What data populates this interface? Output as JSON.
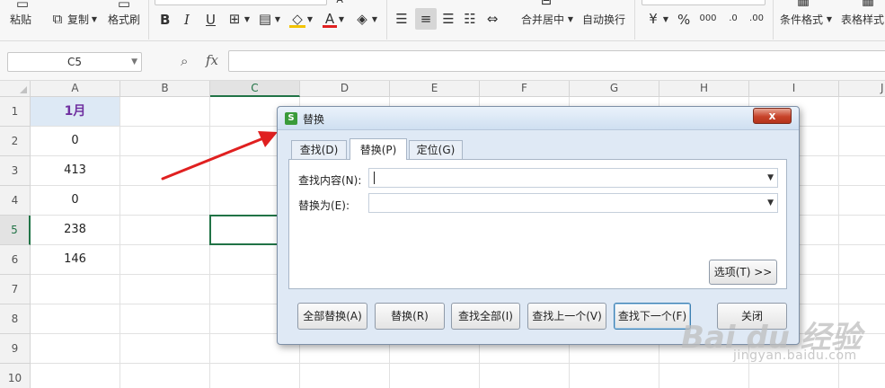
{
  "ribbon": {
    "paste_label": "粘贴",
    "copy_label": "复制",
    "format_painter_label": "格式刷",
    "bold_label": "B",
    "italic_label": "I",
    "underline_label": "U",
    "merge_center_label": "合并居中",
    "wrap_text_label": "自动换行",
    "percent_label": "%",
    "conditional_format_label": "条件格式",
    "table_style_label": "表格样式"
  },
  "formula_bar": {
    "cell_reference": "C5",
    "fx_label": "fx",
    "formula_value": ""
  },
  "sheet": {
    "columns": [
      "A",
      "B",
      "C",
      "D",
      "E",
      "F",
      "G",
      "H",
      "I",
      "J"
    ],
    "selected_column": "C",
    "rows": [
      "1",
      "2",
      "3",
      "4",
      "5",
      "6",
      "7",
      "8",
      "9",
      "10"
    ],
    "selected_row": "5",
    "cells_a": [
      "1月",
      "0",
      "413",
      "0",
      "238",
      "146",
      "",
      "",
      "",
      ""
    ],
    "active_cell": "C5"
  },
  "dialog": {
    "title": "替换",
    "app_icon_letter": "S",
    "close_label": "x",
    "tabs": [
      {
        "label": "查找(D)",
        "active": false
      },
      {
        "label": "替换(P)",
        "active": true
      },
      {
        "label": "定位(G)",
        "active": false
      }
    ],
    "find_label": "查找内容(N):",
    "find_value": "",
    "replace_label": "替换为(E):",
    "replace_value": "",
    "options_label": "选项(T) >>",
    "buttons": {
      "replace_all": "全部替换(A)",
      "replace": "替换(R)",
      "find_all": "查找全部(I)",
      "find_prev": "查找上一个(V)",
      "find_next": "查找下一个(F)",
      "close": "关闭"
    }
  },
  "watermark": {
    "main": "Bai du 经验",
    "sub": "jingyan.baidu.com"
  },
  "colors": {
    "selection_green": "#217346",
    "header_cell_bg": "#dde9f5",
    "header_cell_text": "#7030a0",
    "arrow_red": "#e02020"
  }
}
